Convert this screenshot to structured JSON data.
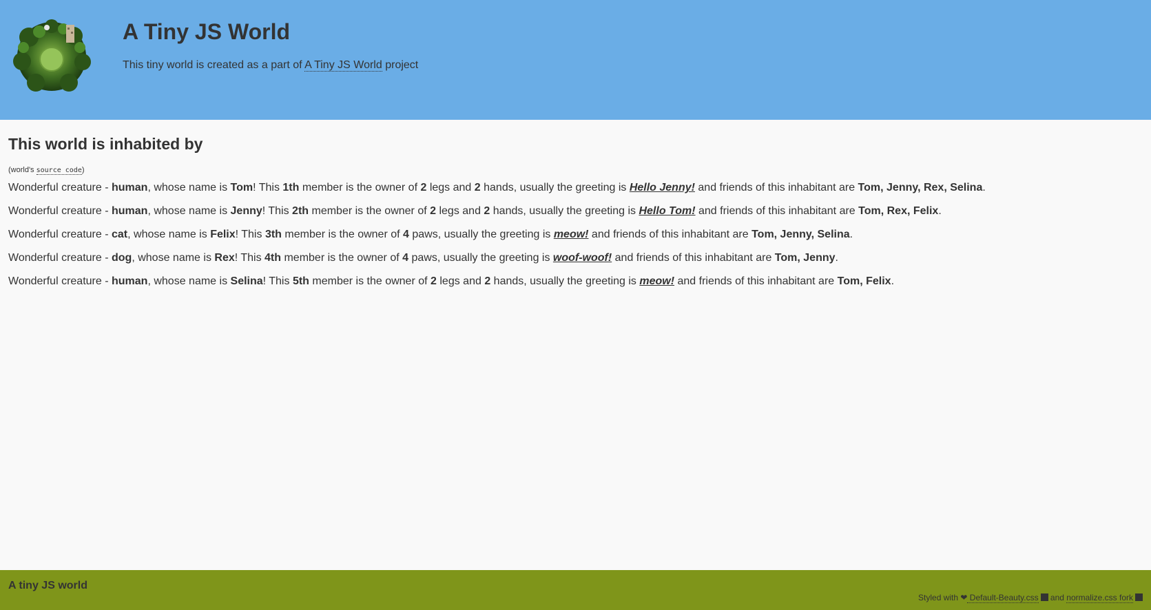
{
  "header": {
    "title": "A Tiny JS World",
    "subtitle_prefix": "This tiny world is created as a part of ",
    "subtitle_link": "A Tiny JS World",
    "subtitle_suffix": " project"
  },
  "main": {
    "heading": "This world is inhabited by",
    "source_prefix": "(world's ",
    "source_link": "source code",
    "source_suffix": ")",
    "inhabitants": [
      {
        "species": "human",
        "name": "Tom",
        "order": "1th",
        "limbs_text_a": "2",
        "limbs_word_a": " legs and ",
        "limbs_text_b": "2",
        "limbs_word_b": " hands",
        "greeting": "Hello Jenny!",
        "friends": "Tom, Jenny, Rex, Selina"
      },
      {
        "species": "human",
        "name": "Jenny",
        "order": "2th",
        "limbs_text_a": "2",
        "limbs_word_a": " legs and ",
        "limbs_text_b": "2",
        "limbs_word_b": " hands",
        "greeting": "Hello Tom!",
        "friends": "Tom, Rex, Felix"
      },
      {
        "species": "cat",
        "name": "Felix",
        "order": "3th",
        "limbs_text_a": "4",
        "limbs_word_a": " paws",
        "limbs_text_b": "",
        "limbs_word_b": "",
        "greeting": "meow!",
        "friends": "Tom, Jenny, Selina"
      },
      {
        "species": "dog",
        "name": "Rex",
        "order": "4th",
        "limbs_text_a": "4",
        "limbs_word_a": " paws",
        "limbs_text_b": "",
        "limbs_word_b": "",
        "greeting": "woof-woof!",
        "friends": "Tom, Jenny"
      },
      {
        "species": "human",
        "name": "Selina",
        "order": "5th",
        "limbs_text_a": "2",
        "limbs_word_a": " legs and ",
        "limbs_text_b": "2",
        "limbs_word_b": " hands",
        "greeting": "meow!",
        "friends": "Tom, Felix"
      }
    ],
    "phrases": {
      "p1": "Wonderful creature - ",
      "p2": ", whose name is ",
      "p3": "! This ",
      "p4": " member is the owner of ",
      "p5": ", usually the greeting is ",
      "p6": " and friends of this inhabitant are ",
      "p7": "."
    }
  },
  "footer": {
    "title": "A tiny JS world",
    "styled_prefix": "Styled with ",
    "heart_icon": "heart-icon",
    "link1": " Default-Beauty.css",
    "and": " and ",
    "link2": "normalize.css fork"
  },
  "colors": {
    "header_bg": "#6aade6",
    "footer_bg": "#7f951a",
    "page_bg": "#f9f9f9",
    "text": "#333333"
  }
}
